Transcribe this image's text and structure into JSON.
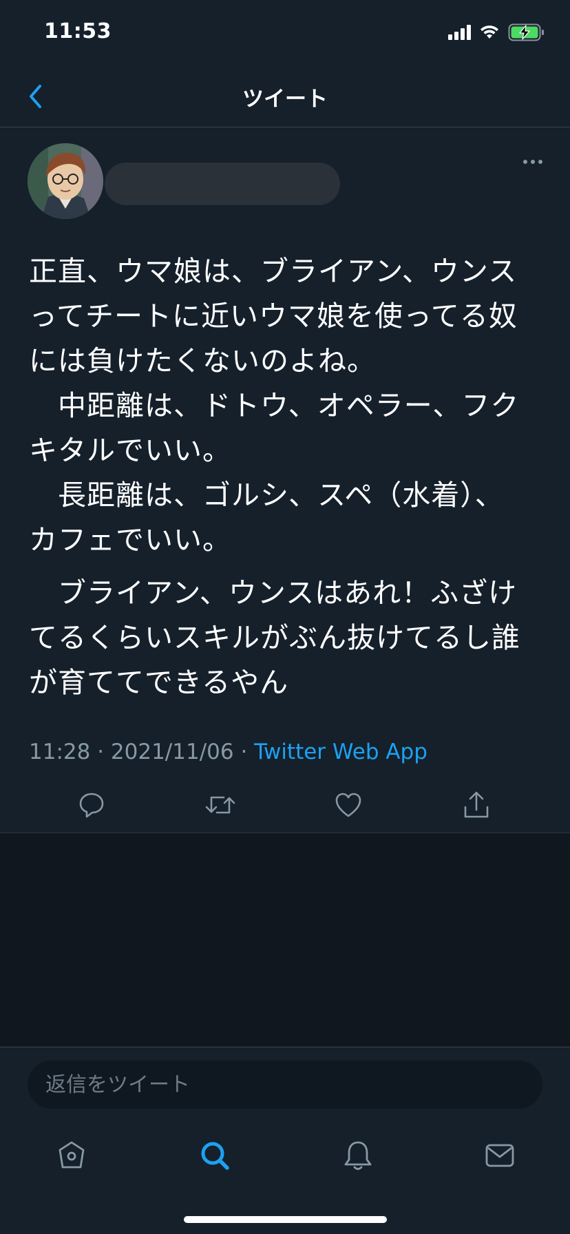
{
  "status_bar": {
    "time": "11:53"
  },
  "nav": {
    "title": "ツイート"
  },
  "tweet": {
    "paragraph1": [
      "正直、ウマ娘は、ブライアン、ウンス",
      "ってチートに近いウマ娘を使ってる奴",
      "には負けたくないのよね。",
      "　中距離は、ドトウ、オペラー、フク",
      "キタルでいい。",
      "　長距離は、ゴルシ、スペ（水着）、",
      "カフェでいい。"
    ],
    "paragraph2": [
      "　ブライアン、ウンスはあれ！ふざけ",
      "てるくらいスキルがぶん抜けてるし誰",
      "が育ててできるやん"
    ],
    "time": "11:28",
    "separator": " · ",
    "date": "2021/11/06",
    "source": "Twitter Web App"
  },
  "reply": {
    "placeholder": "返信をツイート"
  },
  "icons": {
    "back": "chevron-left-icon",
    "reply": "reply-icon",
    "retweet": "retweet-icon",
    "like": "heart-icon",
    "share": "share-icon",
    "home": "home-icon",
    "search": "search-icon",
    "notifications": "bell-icon",
    "messages": "mail-icon"
  },
  "colors": {
    "accent": "#1da1f2",
    "background": "#15202b",
    "secondary_text": "#8899a6",
    "battery": "#4cd964"
  }
}
